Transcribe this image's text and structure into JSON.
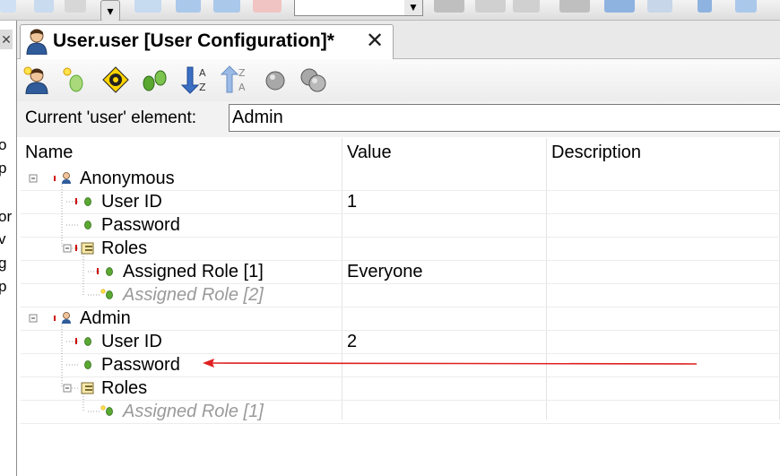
{
  "window": {
    "tab_title": "User.user [User Configuration]*",
    "close_glyph": "✕"
  },
  "icons": {
    "tab": "user-icon",
    "toolbar": [
      "add-user-icon",
      "add-element-icon",
      "target-icon",
      "expand-icon",
      "sort-ascending-icon",
      "sort-descending-icon",
      "gray-ball-icon",
      "gray-balls-icon"
    ]
  },
  "current_element": {
    "label": "Current 'user' element:",
    "value": "Admin"
  },
  "columns": [
    "Name",
    "Value",
    "Description"
  ],
  "left_fragments": [
    "o",
    "p",
    "or",
    "v",
    "g",
    "p"
  ],
  "tree": [
    {
      "label": "Anonymous",
      "value": "",
      "italic": false
    },
    {
      "label": "User ID",
      "value": "1",
      "italic": false
    },
    {
      "label": "Password",
      "value": "",
      "italic": false
    },
    {
      "label": "Roles",
      "value": "",
      "italic": false
    },
    {
      "label": "Assigned Role [1]",
      "value": "Everyone",
      "italic": false
    },
    {
      "label": "Assigned Role [2]",
      "value": "",
      "italic": true
    },
    {
      "label": "Admin",
      "value": "",
      "italic": false
    },
    {
      "label": "User ID",
      "value": "2",
      "italic": false
    },
    {
      "label": "Password",
      "value": "",
      "italic": false
    },
    {
      "label": "Roles",
      "value": "",
      "italic": false
    },
    {
      "label": "Assigned Role [1]",
      "value": "",
      "italic": true
    }
  ],
  "colors": {
    "annotation_arrow": "#e02020",
    "node_green": "#5aa832",
    "required_red": "#d01010"
  }
}
